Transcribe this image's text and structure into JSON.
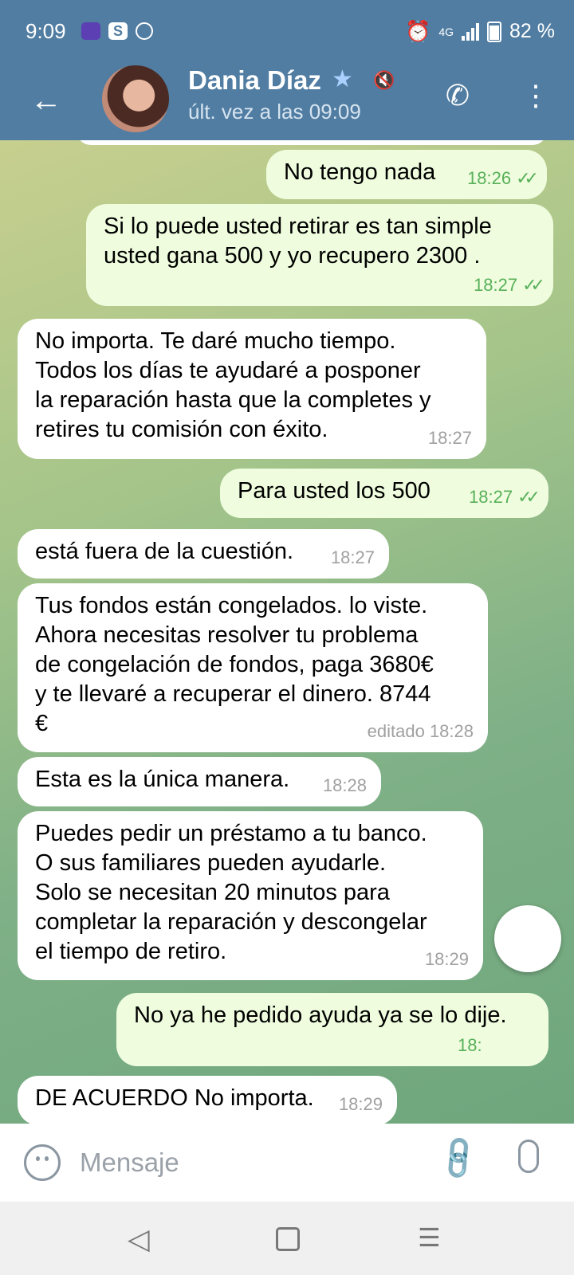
{
  "status_bar": {
    "time": "9:09",
    "network": "4G",
    "battery": "82 %"
  },
  "header": {
    "contact_name": "Dania Díaz",
    "last_seen": "últ. vez a las 09:09",
    "star_icon": "star-icon",
    "mute_icon": "muted-icon"
  },
  "messages": [
    {
      "dir": "out",
      "text": "No tengo nada",
      "time": "18:26"
    },
    {
      "dir": "out",
      "text": "Si lo puede usted retirar es tan simple\nusted gana 500 y yo recupero 2300 .",
      "time": "18:27"
    },
    {
      "dir": "in",
      "text": "No importa. Te daré mucho tiempo.\nTodos los días te ayudaré a posponer\nla reparación hasta que la completes y\nretires tu comisión con éxito.",
      "time": "18:27"
    },
    {
      "dir": "out",
      "text": "Para usted los 500",
      "time": "18:27"
    },
    {
      "dir": "in",
      "text": "está fuera de la cuestión.",
      "time": "18:27"
    },
    {
      "dir": "in",
      "text": "Tus fondos están congelados. lo viste.\nAhora necesitas resolver tu problema\nde congelación de fondos, paga 3680€\ny te llevaré a recuperar el dinero. 8744\n€",
      "time": "editado 18:28"
    },
    {
      "dir": "in",
      "text": "Esta es la única manera.",
      "time": "18:28"
    },
    {
      "dir": "in",
      "text": "Puedes pedir un préstamo a tu banco.\nO sus familiares pueden ayudarle.\nSolo se necesitan 20 minutos para\ncompletar la reparación y descongelar\nel tiempo de retiro.",
      "time": "18:29"
    },
    {
      "dir": "out",
      "text": "No ya he pedido ayuda ya se lo dije.",
      "time": "18:"
    },
    {
      "dir": "in",
      "text": "DE ACUERDO No importa.",
      "time": "18:29"
    }
  ],
  "input": {
    "placeholder": "Mensaje"
  },
  "colors": {
    "header": "#517da2",
    "outgoing_bubble": "#effdde",
    "incoming_bubble": "#ffffff",
    "read_checks": "#59b05a"
  }
}
